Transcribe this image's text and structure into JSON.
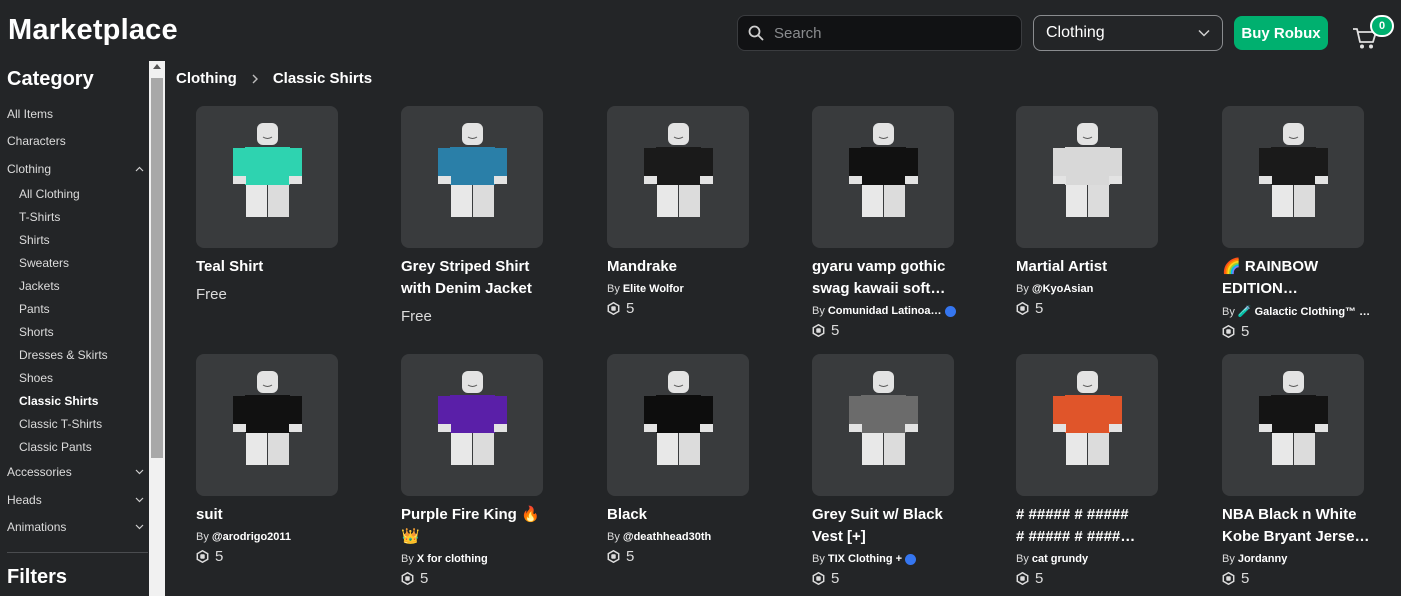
{
  "header": {
    "title": "Marketplace",
    "search_placeholder": "Search",
    "category_selected": "Clothing",
    "buy_robux_label": "Buy Robux",
    "cart_count": "0",
    "accent_color": "#00b06f"
  },
  "sidebar": {
    "category_heading": "Category",
    "filters_heading": "Filters",
    "items": [
      {
        "label": "All Items"
      },
      {
        "label": "Characters"
      },
      {
        "label": "Clothing"
      },
      {
        "label": "All Clothing"
      },
      {
        "label": "T-Shirts"
      },
      {
        "label": "Shirts"
      },
      {
        "label": "Sweaters"
      },
      {
        "label": "Jackets"
      },
      {
        "label": "Pants"
      },
      {
        "label": "Shorts"
      },
      {
        "label": "Dresses & Skirts"
      },
      {
        "label": "Shoes"
      },
      {
        "label": "Classic Shirts"
      },
      {
        "label": "Classic T-Shirts"
      },
      {
        "label": "Classic Pants"
      },
      {
        "label": "Accessories"
      },
      {
        "label": "Heads"
      },
      {
        "label": "Animations"
      }
    ]
  },
  "breadcrumb": {
    "parent": "Clothing",
    "current": "Classic Shirts"
  },
  "items": [
    {
      "name_line1": "Teal Shirt",
      "name_line2": "",
      "creator": "",
      "price": "Free",
      "shirt_color": "#2ed3b0"
    },
    {
      "name_line1": "Grey Striped Shirt",
      "name_line2": "with Denim Jacket",
      "creator": "",
      "price": "Free",
      "shirt_color": "#2a7fa8"
    },
    {
      "name_line1": "Mandrake",
      "name_line2": "",
      "by": "By",
      "creator": "Elite Wolfor",
      "price": "5",
      "shirt_color": "#1a1a1a"
    },
    {
      "name_line1": "gyaru vamp gothic",
      "name_line2": "swag kawaii soft…",
      "by": "By",
      "creator": "Comunidad Latinoa…",
      "price": "5",
      "shirt_color": "#111111"
    },
    {
      "name_line1": "Martial Artist",
      "name_line2": "",
      "by": "By",
      "creator": "@KyoAsian",
      "price": "5",
      "shirt_color": "#d8d8d8"
    },
    {
      "name_line1": "🌈 RAINBOW",
      "name_line2": "EDITION…",
      "by": "By",
      "creator": "🧪 Galactic Clothing™ …",
      "price": "5",
      "shirt_color": "#1a1a1a"
    },
    {
      "name_line1": "suit",
      "name_line2": "",
      "by": "By",
      "creator": "@arodrigo2011",
      "price": "5",
      "shirt_color": "#111111"
    },
    {
      "name_line1": "Purple Fire King 🔥",
      "name_line2": "👑",
      "by": "By",
      "creator": "X for clothing",
      "price": "5",
      "shirt_color": "#5a1fa8"
    },
    {
      "name_line1": "Black",
      "name_line2": "",
      "by": "By",
      "creator": "@deathhead30th",
      "price": "5",
      "shirt_color": "#0d0d0d"
    },
    {
      "name_line1": "Grey Suit w/ Black",
      "name_line2": "Vest [+]",
      "by": "By",
      "creator": "TIX Clothing +",
      "price": "5",
      "shirt_color": "#6b6b6b"
    },
    {
      "name_line1": "# ##### # #####",
      "name_line2": "# ##### # ####…",
      "by": "By",
      "creator": "cat grundy",
      "price": "5",
      "shirt_color": "#e0552a"
    },
    {
      "name_line1": "NBA Black n White",
      "name_line2": "Kobe Bryant Jerse…",
      "by": "By",
      "creator": "Jordanny",
      "price": "5",
      "shirt_color": "#141414"
    }
  ]
}
